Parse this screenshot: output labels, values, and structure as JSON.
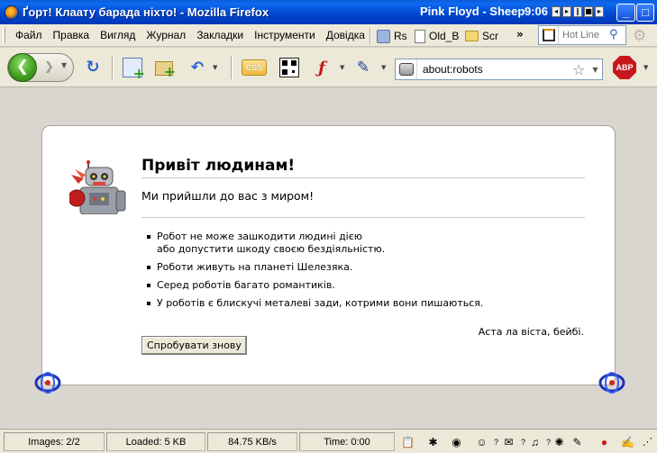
{
  "window": {
    "title": "Ґорт! Клаату барада ніхто! - Mozilla Firefox",
    "now_playing": "Pink Floyd - Sheep",
    "clock": "9:06",
    "minimize": "_",
    "maximize": "□",
    "close": "X"
  },
  "menubar": {
    "items": [
      "Файл",
      "Правка",
      "Вигляд",
      "Журнал",
      "Закладки",
      "Інструменти",
      "Довідка"
    ],
    "bookmarks": [
      "Rs",
      "Old_B",
      "Scr"
    ],
    "overflow": "»",
    "search_placeholder": "Hot Line"
  },
  "toolbar": {
    "css_label": "CSS",
    "url": "about:robots",
    "adblock_label": "ABP"
  },
  "page": {
    "heading": "Привіт людинам!",
    "subheading": "Ми прийшли до вас з миром!",
    "laws": [
      "Робот не може зашкодити людині дією",
      "або допустити шкоду своєю бездіяльністю.",
      "Роботи живуть на планеті Шелезяка.",
      "Серед роботів багато романтиків.",
      "У роботів є блискучі металеві зади, котрими вони пишаються."
    ],
    "farewell": "Аста ла віста, бейбі.",
    "try_again": "Спробувати знову"
  },
  "statusbar": {
    "images": "Images: 2/2",
    "loaded": "Loaded: 5 KB",
    "speed": "84.75 KB/s",
    "time": "Time: 0:00"
  },
  "colors": {
    "titlebar": "#0049d0",
    "chrome": "#ece9d8",
    "content_bg": "#d9d6cf",
    "panel_bg": "#ffffff",
    "back_button": "#3c9b1e",
    "adblock": "#c8161d"
  },
  "icons": {
    "window": "firefox-icon",
    "back": "back-arrow-icon",
    "forward": "forward-arrow-icon",
    "reload": "reload-icon",
    "new_tab": "new-tab-icon",
    "new_folder": "new-folder-icon",
    "undo": "undo-icon",
    "css": "css-icon",
    "qr": "qr-code-icon",
    "flash": "flash-block-icon",
    "edit": "pen-icon",
    "bookmark_star": "star-icon",
    "robot": "robot-icon"
  }
}
